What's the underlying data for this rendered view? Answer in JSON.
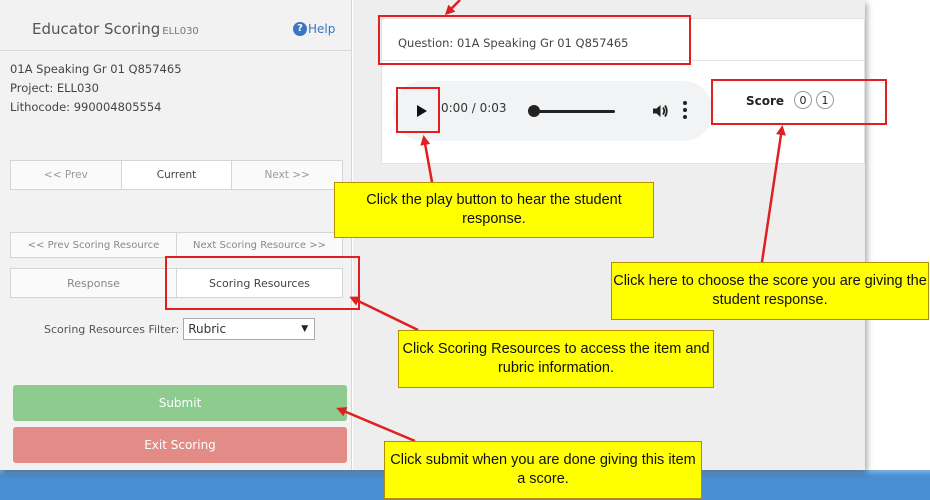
{
  "sidebar": {
    "title": "Educator Scoring",
    "title_code": "ELL030",
    "help_label": "Help",
    "item_name": "01A Speaking Gr 01 Q857465",
    "project": "Project: ELL030",
    "lithocode": "Lithocode: 990004805554",
    "nav": {
      "prev": "<< Prev",
      "current": "Current",
      "next": "Next >>"
    },
    "resources_nav": {
      "prev": "<< Prev Scoring Resource",
      "next": "Next Scoring Resource >>"
    },
    "tabs": {
      "response": "Response",
      "scoring_resources": "Scoring Resources"
    },
    "filter": {
      "label": "Scoring Resources Filter:",
      "value": "Rubric"
    },
    "submit_label": "Submit",
    "exit_label": "Exit Scoring"
  },
  "main": {
    "question": "Question: 01A Speaking Gr 01 Q857465",
    "player": {
      "time": "0:00 / 0:03"
    },
    "score": {
      "label": "Score",
      "options": [
        "0",
        "1"
      ]
    }
  },
  "annotations": {
    "play": "Click the play button to hear the student response.",
    "score": "Click here to choose the score you are giving the student response.",
    "resources": "Click Scoring Resources to access the item and rubric information.",
    "submit": "Click submit when you are done giving this item a score."
  },
  "colors": {
    "annotation_red": "#e02020",
    "callout_yellow": "#ffff00",
    "submit_green": "#8ecb8e",
    "exit_red": "#e38b87",
    "help_blue": "#3a76c4",
    "band_blue": "#4a8fd1"
  },
  "icons": [
    "help-icon",
    "play-icon",
    "volume-icon",
    "more-vertical-icon",
    "dropdown-caret-icon"
  ]
}
